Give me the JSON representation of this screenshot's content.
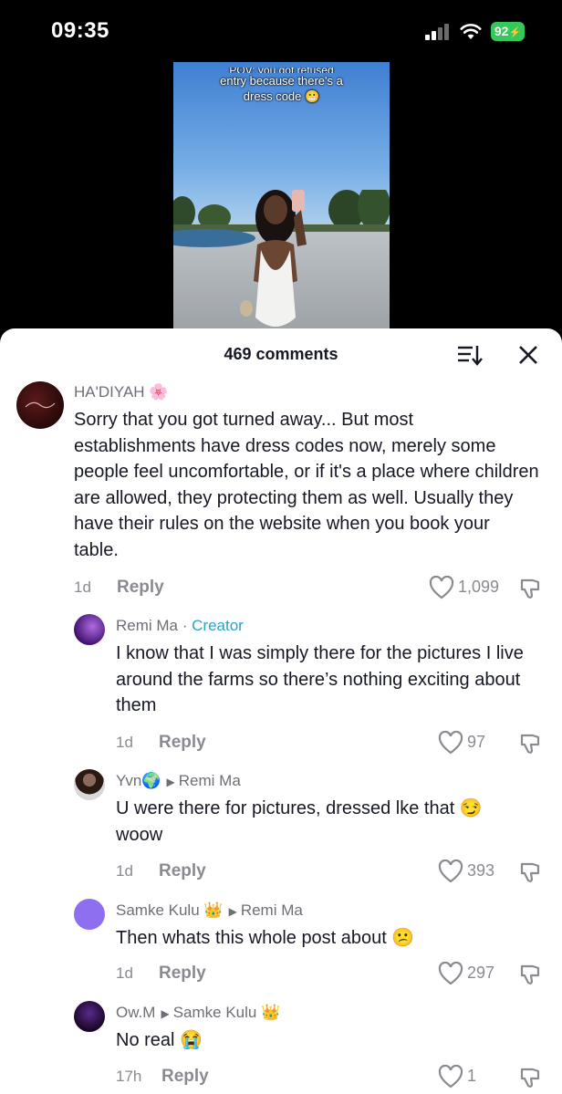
{
  "status_bar": {
    "time": "09:35",
    "battery": "92"
  },
  "video": {
    "caption_line1": "POV: you got refused",
    "caption_line2": "entry because there's a",
    "caption_line3": "dress code"
  },
  "comments_header": {
    "count_label": "469 comments"
  },
  "comments": [
    {
      "author": "HA'DIYAH",
      "text": "Sorry that you got turned away... But most establishments have dress codes now, merely some people feel uncomfortable, or if it's a place where children are allowed, they protecting them as well. Usually they have their rules on the website when you book your table.",
      "age": "1d",
      "reply_label": "Reply",
      "likes": "1,099"
    },
    {
      "author": "Remi Ma",
      "separator": "·",
      "badge": "Creator",
      "text": "I know that I was simply there for the pictures I live around the farms so there’s nothing exciting about them",
      "age": "1d",
      "reply_label": "Reply",
      "likes": "97"
    },
    {
      "author": "Yvn",
      "reply_to": "Remi Ma",
      "text": "U were there for pictures, dressed lke that",
      "text_line2": "woow",
      "age": "1d",
      "reply_label": "Reply",
      "likes": "393"
    },
    {
      "author": "Samke Kulu",
      "reply_to": "Remi Ma",
      "text": "Then whats this whole post about",
      "age": "1d",
      "reply_label": "Reply",
      "likes": "297"
    },
    {
      "author": "Ow.M",
      "reply_to": "Samke Kulu",
      "text": "No real",
      "age": "17h",
      "reply_label": "Reply",
      "likes": "1"
    }
  ],
  "icons": {
    "sort": "sort-icon",
    "close": "close-icon",
    "like": "heart-outline-icon",
    "dislike": "thumbs-down-icon",
    "reply_arrow": "triangle-right-icon"
  },
  "colors": {
    "creator_badge": "#2ba3c6",
    "battery": "#34c759",
    "text": "#161823",
    "muted": "#8a8b91"
  }
}
